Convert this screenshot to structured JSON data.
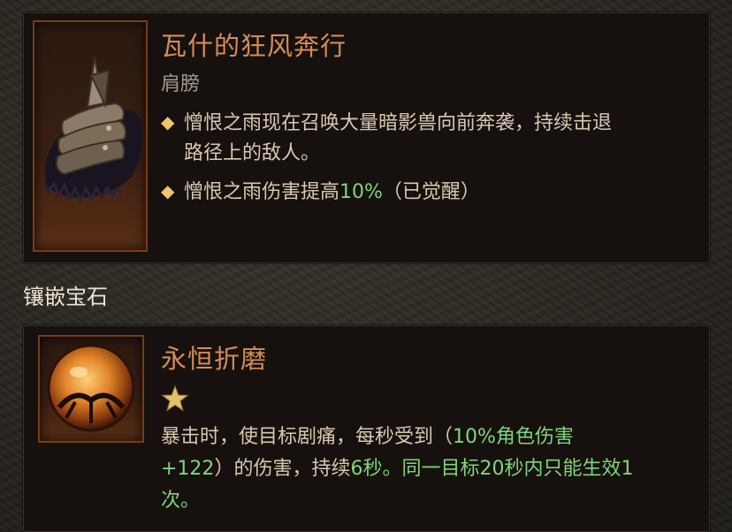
{
  "item": {
    "name": "瓦什的狂风奔行",
    "slot": "肩膀",
    "affixes": [
      {
        "line1": "憎恨之雨现在召唤大量暗影兽向前奔袭，持续击退",
        "line2": "路径上的敌人。"
      },
      {
        "prefix": "憎恨之雨伤害提高",
        "value": "10%",
        "suffix": "（已觉醒）"
      }
    ]
  },
  "section": {
    "socketed_gems_label": "镶嵌宝石"
  },
  "gem": {
    "name": "永恒折磨",
    "desc": {
      "p1": "暴击时，使目标剧痛，每秒受到（",
      "g1": "10%角色伤害",
      "g2": "+122",
      "p2": "）的伤害，持续",
      "g3": "6秒。同一目标20秒内只能生效1",
      "g4": "次。"
    }
  },
  "colors": {
    "title": "#d58c58",
    "highlight": "#7fd57a",
    "affix_diamond": "#f0c56a",
    "frame": "#7a3a1c"
  },
  "icons": {
    "item": "shoulder-armor-icon",
    "gem": "amber-gem-icon",
    "rank": "star-icon",
    "affix": "diamond-bullet-icon"
  }
}
